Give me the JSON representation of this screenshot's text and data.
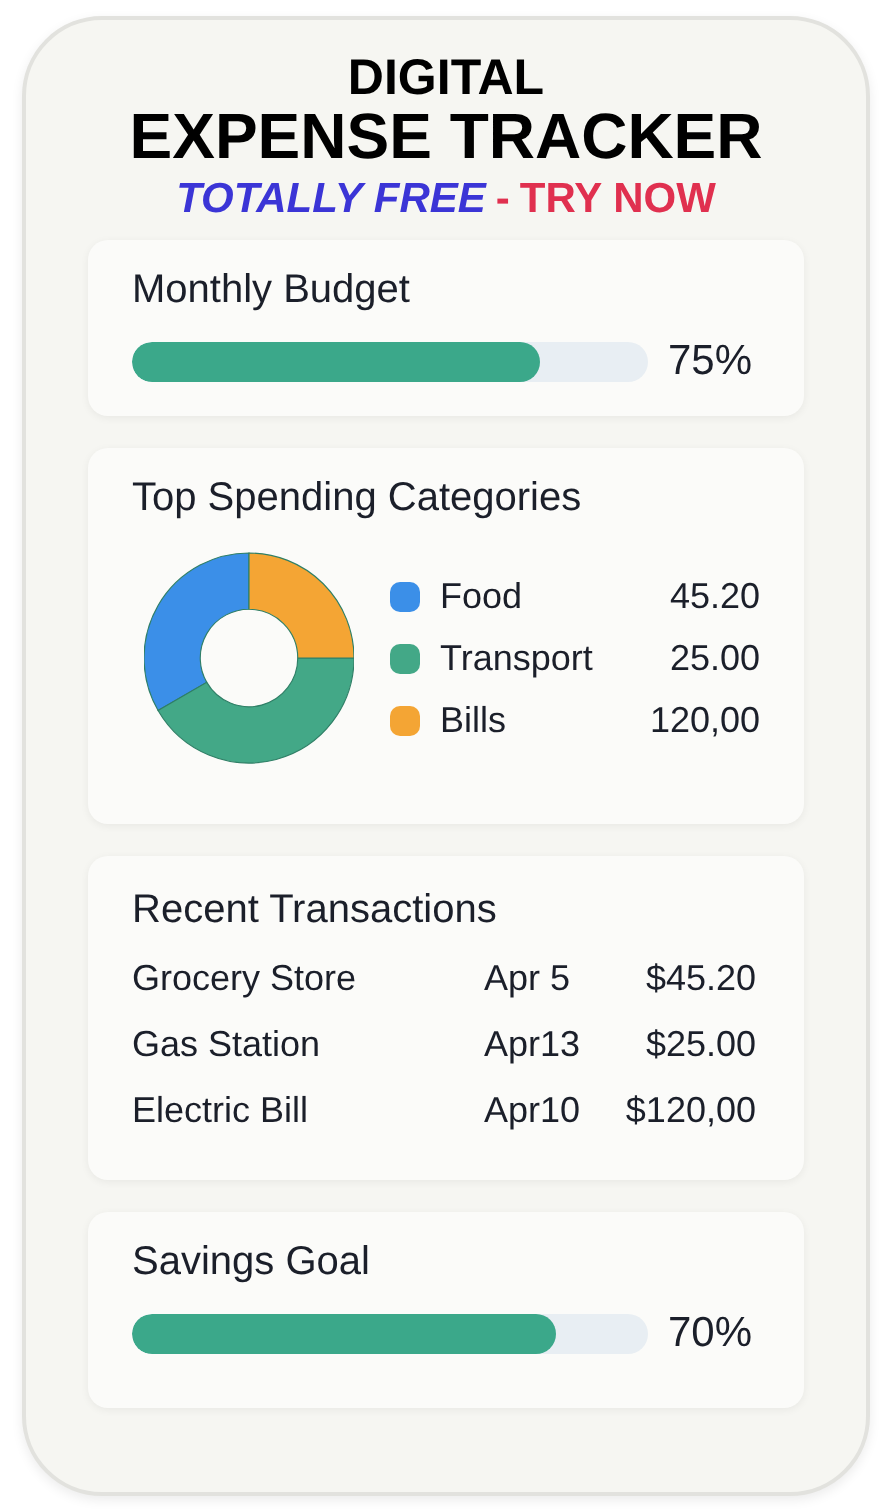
{
  "header": {
    "line_1": "DIGITAL",
    "line_2": "EXPENSE TRACKER",
    "offer": "TOTALLY FREE",
    "separator": "-",
    "cta": "TRY NOW"
  },
  "budget": {
    "title": "Monthly Budget",
    "level": 0.79,
    "reading": "75%"
  },
  "categories": {
    "title": "Top Spending Categories",
    "items": [
      {
        "name": "Food",
        "amount": "45.20",
        "color": "#3b8fe8"
      },
      {
        "name": "Transport",
        "amount": "25.00",
        "color": "#43a887"
      },
      {
        "name": "Bills",
        "amount": "120,00",
        "color": "#f4a534"
      }
    ]
  },
  "transactions": {
    "title": "Recent Transactions",
    "rows": [
      {
        "name": "Grocery Store",
        "date": "Apr 5",
        "amount": "$45.20"
      },
      {
        "name": "Gas Station",
        "date": "Apr13",
        "amount": "$25.00"
      },
      {
        "name": "Electric Bill",
        "date": "Apr10",
        "amount": "$120,00"
      }
    ]
  },
  "savings": {
    "title": "Savings Goal",
    "level": 0.82,
    "reading": "70%"
  }
}
